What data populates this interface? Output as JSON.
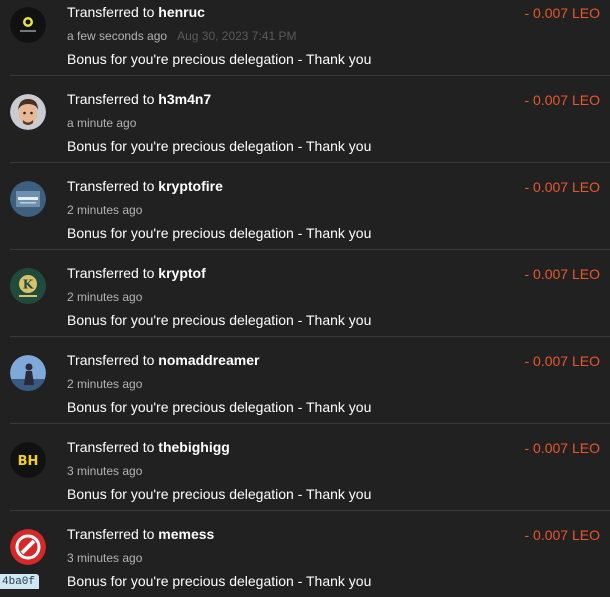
{
  "transfers": [
    {
      "prefix": "Transferred to",
      "user": "henruc",
      "time": "a few seconds ago",
      "hover_date": "Aug 30, 2023 7:41 PM",
      "memo": "Bonus for you're precious delegation - Thank you",
      "amount": "- 0.007 LEO",
      "avatar": "henruc-avatar"
    },
    {
      "prefix": "Transferred to",
      "user": "h3m4n7",
      "time": "a minute ago",
      "memo": "Bonus for you're precious delegation - Thank you",
      "amount": "- 0.007 LEO",
      "avatar": "h3m4n7-avatar"
    },
    {
      "prefix": "Transferred to",
      "user": "kryptofire",
      "time": "2 minutes ago",
      "memo": "Bonus for you're precious delegation - Thank you",
      "amount": "- 0.007 LEO",
      "avatar": "kryptofire-avatar"
    },
    {
      "prefix": "Transferred to",
      "user": "kryptof",
      "time": "2 minutes ago",
      "memo": "Bonus for you're precious delegation - Thank you",
      "amount": "- 0.007 LEO",
      "avatar": "kryptof-avatar"
    },
    {
      "prefix": "Transferred to",
      "user": "nomaddreamer",
      "time": "2 minutes ago",
      "memo": "Bonus for you're precious delegation - Thank you",
      "amount": "- 0.007 LEO",
      "avatar": "nomaddreamer-avatar"
    },
    {
      "prefix": "Transferred to",
      "user": "thebighigg",
      "time": "3 minutes ago",
      "memo": "Bonus for you're precious delegation - Thank you",
      "amount": "- 0.007 LEO",
      "avatar": "thebighigg-avatar"
    },
    {
      "prefix": "Transferred to",
      "user": "memess",
      "time": "3 minutes ago",
      "memo": "Bonus for you're precious delegation - Thank you",
      "amount": "- 0.007 LEO",
      "avatar": "memess-avatar"
    }
  ],
  "debug_tag": "4ba0f",
  "colors": {
    "background": "#212121",
    "amount": "#e6582b",
    "divider": "#3a3a3a"
  },
  "avatar_text": {
    "bh": "BH",
    "k": "K"
  }
}
